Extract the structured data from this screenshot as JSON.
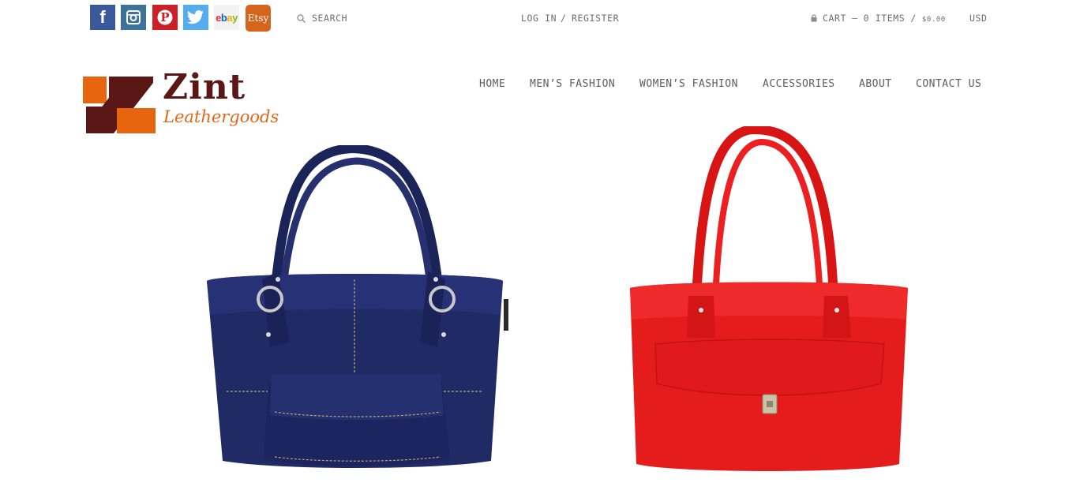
{
  "social": [
    {
      "name": "facebook-icon",
      "glyph": "f",
      "color": "#3b5998"
    },
    {
      "name": "instagram-icon",
      "glyph": "",
      "color": "#3f729b"
    },
    {
      "name": "pinterest-icon",
      "glyph": "P",
      "color": "#cb2027"
    },
    {
      "name": "twitter-icon",
      "glyph": "",
      "color": "#55acee"
    },
    {
      "name": "ebay-icon",
      "glyph": "ebay",
      "color": "#f2f2f2"
    },
    {
      "name": "etsy-icon",
      "glyph": "Etsy",
      "color": "#d5641c"
    }
  ],
  "search": {
    "placeholder": "SEARCH"
  },
  "account": {
    "login": "LOG IN",
    "separator": "/",
    "register": "REGISTER"
  },
  "cart": {
    "label": "CART",
    "dash": "–",
    "items": "0 ITEMS",
    "slash": "/",
    "total": "$0.00"
  },
  "currency": "USD",
  "logo": {
    "word": "Zint",
    "subtitle": "Leathergoods",
    "colors": {
      "orange": "#e8650f",
      "maroon": "#5b1716"
    }
  },
  "nav": [
    {
      "label": "HOME"
    },
    {
      "label": "MEN’S FASHION"
    },
    {
      "label": "WOMEN’S FASHION"
    },
    {
      "label": "ACCESSORIES"
    },
    {
      "label": "ABOUT"
    },
    {
      "label": "CONTACT US"
    }
  ],
  "products": [
    {
      "name": "navy leather handbag",
      "color": "#1f2a63"
    },
    {
      "name": "red leather handbag",
      "color": "#e31b1b"
    }
  ]
}
